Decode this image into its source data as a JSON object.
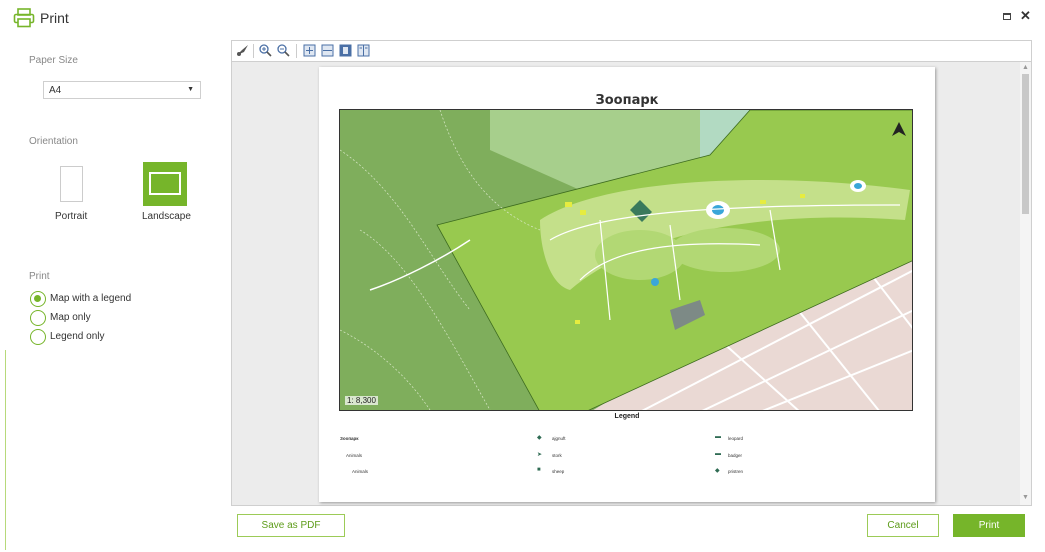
{
  "window": {
    "title": "Print",
    "maximize_icon": "maximize-icon",
    "close_icon": "close-icon",
    "close_glyph": "✕"
  },
  "settings": {
    "paper_size_label": "Paper Size",
    "paper_size_value": "A4",
    "orientation_label": "Orientation",
    "portrait_label": "Portrait",
    "landscape_label": "Landscape",
    "orientation_selected": "Landscape",
    "print_label": "Print",
    "print_options": [
      {
        "label": "Map with a legend",
        "checked": true
      },
      {
        "label": "Map only",
        "checked": false
      },
      {
        "label": "Legend only",
        "checked": false
      }
    ]
  },
  "toolbar": {
    "icons": [
      "brush-icon",
      "zoom-in-icon",
      "zoom-out-icon",
      "fit-page-icon",
      "fit-width-icon",
      "single-page-icon",
      "two-pages-icon"
    ]
  },
  "preview": {
    "map_title": "Зоопарк",
    "scale": "1: 8,300",
    "legend_title": "Legend",
    "legend": {
      "col1": [
        "Зоопарк",
        "Animals",
        "Animals"
      ],
      "col2": [
        "ajgnuft",
        "stork",
        "sheep"
      ],
      "col3": [
        "leopard",
        "badger",
        "pristren"
      ]
    }
  },
  "buttons": {
    "save_pdf": "Save as PDF",
    "cancel": "Cancel",
    "print": "Print"
  },
  "colors": {
    "accent": "#76b52a",
    "map_forest": "#7fae5c",
    "map_zoo": "#98c94f"
  }
}
